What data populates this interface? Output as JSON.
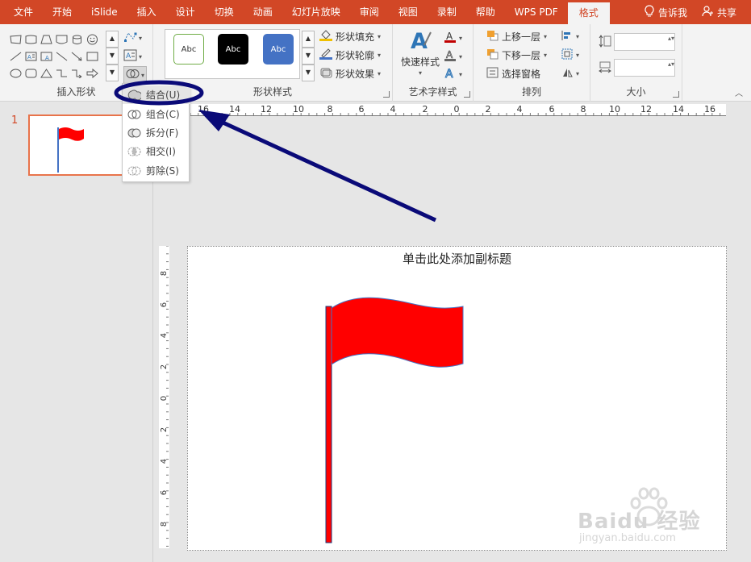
{
  "ribbon_tabs": [
    "文件",
    "开始",
    "iSlide",
    "插入",
    "设计",
    "切换",
    "动画",
    "幻灯片放映",
    "审阅",
    "视图",
    "录制",
    "帮助",
    "WPS PDF",
    "格式"
  ],
  "active_tab": "格式",
  "tell_me": "告诉我",
  "share": "共享",
  "groups": {
    "insert_shapes": "插入形状",
    "shape_styles": "形状样式",
    "wordart_styles": "艺术字样式",
    "arrange": "排列",
    "size": "大小"
  },
  "style_swatches": [
    "Abc",
    "Abc",
    "Abc"
  ],
  "shape_fill": "形状填充",
  "shape_outline": "形状轮廓",
  "shape_effects": "形状效果",
  "quick_styles": "快速样式",
  "bring_forward": "上移一层",
  "send_backward": "下移一层",
  "selection_pane": "选择窗格",
  "merge_menu": [
    {
      "label": "结合(U)",
      "icon": "union-icon"
    },
    {
      "label": "组合(C)",
      "icon": "combine-icon"
    },
    {
      "label": "拆分(F)",
      "icon": "fragment-icon"
    },
    {
      "label": "相交(I)",
      "icon": "intersect-icon"
    },
    {
      "label": "剪除(S)",
      "icon": "subtract-icon"
    }
  ],
  "slide_number": "1",
  "slide_subtitle": "单击此处添加副标题",
  "ruler_h": [
    "16",
    "14",
    "12",
    "10",
    "8",
    "6",
    "4",
    "2",
    "0",
    "2",
    "4",
    "6",
    "8",
    "10",
    "12",
    "14",
    "16"
  ],
  "ruler_v": [
    "8",
    "6",
    "4",
    "2",
    "0",
    "2",
    "4",
    "6",
    "8"
  ],
  "watermark_text": "Baidu 经验",
  "watermark_url": "jingyan.baidu.com",
  "colors": {
    "accent": "#d24726",
    "flag_red": "#ff0000",
    "annotation_navy": "#0a0a78",
    "swatch_black": "#000000",
    "swatch_blue": "#4472c4",
    "swatch_green_border": "#70ad47"
  }
}
